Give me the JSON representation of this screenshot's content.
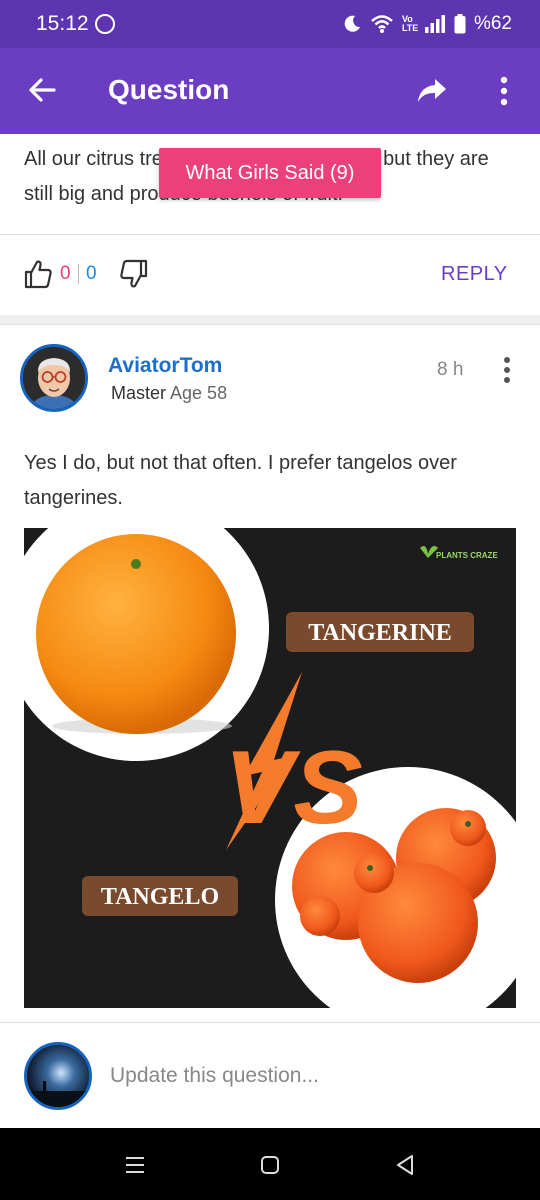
{
  "status_bar": {
    "time": "15:12",
    "network_label": "Vo LTE",
    "battery": "%62"
  },
  "app_bar": {
    "title": "Question"
  },
  "previous_answer": {
    "text": "All our citrus trees are kept pruned back but they are still big and produce bushels of fruit.",
    "tooltip": "What Girls Said (9)",
    "upvotes": "0",
    "downvotes": "0",
    "reply_label": "REPLY"
  },
  "post": {
    "username": "AviatorTom",
    "rank": "Master",
    "age": "Age 58",
    "time_ago": "8 h",
    "body": "Yes I do, but not that often. I prefer tangelos over tangerines.",
    "image": {
      "brand": "PLANTS CRAZE",
      "label_top": "TANGERINE",
      "vs": "VS",
      "label_bottom": "TANGELO"
    }
  },
  "composer": {
    "placeholder": "Update this question..."
  },
  "colors": {
    "primary": "#6a3dc2",
    "accent_pink": "#ec407a",
    "link_blue": "#1e6fc9"
  }
}
